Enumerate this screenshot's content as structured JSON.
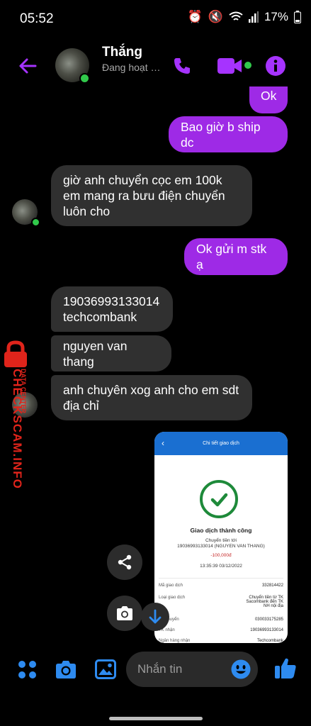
{
  "status_bar": {
    "time": "05:52",
    "battery": "17%"
  },
  "header": {
    "contact_name": "Thắng",
    "status": "Đang hoạt động"
  },
  "messages": [
    {
      "side": "out",
      "text": "Ok"
    },
    {
      "side": "out",
      "text": "Bao giờ b ship dc"
    },
    {
      "side": "in",
      "text": "giờ anh chuyển cọc em 100k em mang ra bưu điện chuyển luôn cho"
    },
    {
      "side": "out",
      "text": "Ok gửi m stk ạ"
    },
    {
      "side": "in",
      "text": "19036993133014 techcombank"
    },
    {
      "side": "in",
      "text": "nguyen van thang"
    },
    {
      "side": "in",
      "text": "anh chuyên xog anh cho em sdt địa chỉ"
    }
  ],
  "transfer_screenshot": {
    "title": "Chi tiết giao dịch",
    "result": "Giao dịch thành công",
    "from_label": "Chuyển tiền tới",
    "recipient": "19036993133014 (NGUYEN VAN THANG)",
    "amount": "-100,000đ",
    "datetime": "13:35:39 03/12/2022",
    "rows": [
      {
        "label": "Mã giao dịch",
        "value": "332814422"
      },
      {
        "label": "Loại giao dịch",
        "value": "Chuyển tiền từ TK Sacombank đến TK NH nội địa"
      },
      {
        "label": "TK chuyển",
        "value": "030033175285"
      },
      {
        "label": "TK nhận",
        "value": "19036993133014"
      },
      {
        "label": "Ngân hàng nhận",
        "value": "Techcombank"
      }
    ]
  },
  "composer": {
    "placeholder": "Nhắn tin"
  },
  "watermark": {
    "brand": "CHECKSCAM.INFO",
    "tagline": "DATA CENTER"
  },
  "colors": {
    "accent": "#a633ff",
    "outgoing_bubble": "#9e2ae6",
    "incoming_bubble": "#303030",
    "composer_icons": "#2e8bf0",
    "online": "#31c94b"
  },
  "icons": {
    "back": "arrow-left-icon",
    "call": "phone-icon",
    "video": "video-camera-icon",
    "info": "info-icon",
    "share": "share-icon",
    "camera": "camera-icon",
    "download": "arrow-down-icon",
    "apps": "four-dots-icon",
    "gallery": "image-icon",
    "emoji": "emoji-icon",
    "like": "thumbs-up-icon"
  }
}
